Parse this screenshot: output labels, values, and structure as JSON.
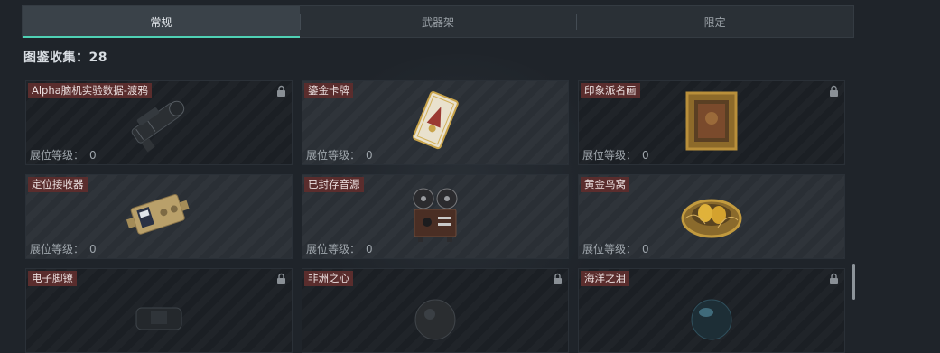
{
  "tabs": [
    {
      "label": "常规",
      "active": true
    },
    {
      "label": "武器架",
      "active": false
    },
    {
      "label": "限定",
      "active": false
    }
  ],
  "collection": {
    "label": "图鉴收集：28"
  },
  "accent_color": "#4fd1b4",
  "items": [
    {
      "name": "Alpha脑机实验数据-渡鸦",
      "level_label": "展位等级：",
      "level": "0",
      "locked": true,
      "icon": "camera-gear-icon"
    },
    {
      "name": "鎏金卡牌",
      "level_label": "展位等级：",
      "level": "0",
      "locked": false,
      "icon": "gilded-card-icon"
    },
    {
      "name": "印象派名画",
      "level_label": "展位等级：",
      "level": "0",
      "locked": true,
      "icon": "framed-painting-icon"
    },
    {
      "name": "定位接收器",
      "level_label": "展位等级：",
      "level": "0",
      "locked": false,
      "icon": "receiver-device-icon"
    },
    {
      "name": "已封存音源",
      "level_label": "展位等级：",
      "level": "0",
      "locked": false,
      "icon": "reel-recorder-icon"
    },
    {
      "name": "黄金鸟窝",
      "level_label": "展位等级：",
      "level": "0",
      "locked": false,
      "icon": "golden-nest-icon"
    },
    {
      "name": "电子脚镣",
      "locked": true,
      "icon": "ankle-monitor-icon"
    },
    {
      "name": "非洲之心",
      "locked": true,
      "icon": "dark-gem-icon"
    },
    {
      "name": "海洋之泪",
      "locked": true,
      "icon": "ocean-gem-icon"
    }
  ]
}
